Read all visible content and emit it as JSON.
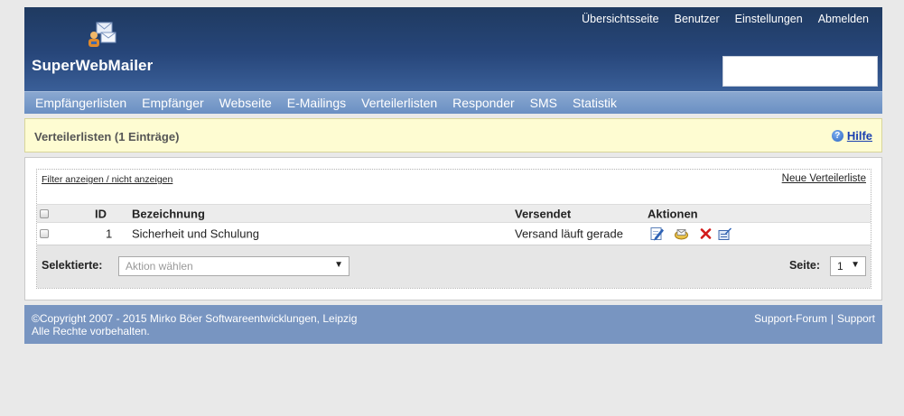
{
  "brand": "SuperWebMailer",
  "topnav": [
    "Übersichtsseite",
    "Benutzer",
    "Einstellungen",
    "Abmelden"
  ],
  "mainnav": [
    "Empfängerlisten",
    "Empfänger",
    "Webseite",
    "E-Mailings",
    "Verteilerlisten",
    "Responder",
    "SMS",
    "Statistik"
  ],
  "titlebar": {
    "title": "Verteilerlisten (1 Einträge)",
    "help": "Hilfe"
  },
  "links": {
    "filter": "Filter anzeigen / nicht anzeigen",
    "new_list": "Neue Verteilerliste"
  },
  "table": {
    "headers": {
      "id": "ID",
      "name": "Bezeichnung",
      "sent": "Versendet",
      "actions": "Aktionen"
    },
    "rows": [
      {
        "id": "1",
        "name": "Sicherheit und Schulung",
        "sent": "Versand läuft gerade"
      }
    ]
  },
  "bulk": {
    "label": "Selektierte:",
    "placeholder": "Aktion wählen"
  },
  "pager": {
    "label": "Seite:",
    "value": "1"
  },
  "footer": {
    "copyright": "©Copyright 2007 - 2015 Mirko Böer Softwareentwicklungen, Leipzig",
    "rights": "Alle Rechte vorbehalten.",
    "support_forum": "Support-Forum",
    "separator": "|",
    "support": "Support"
  }
}
